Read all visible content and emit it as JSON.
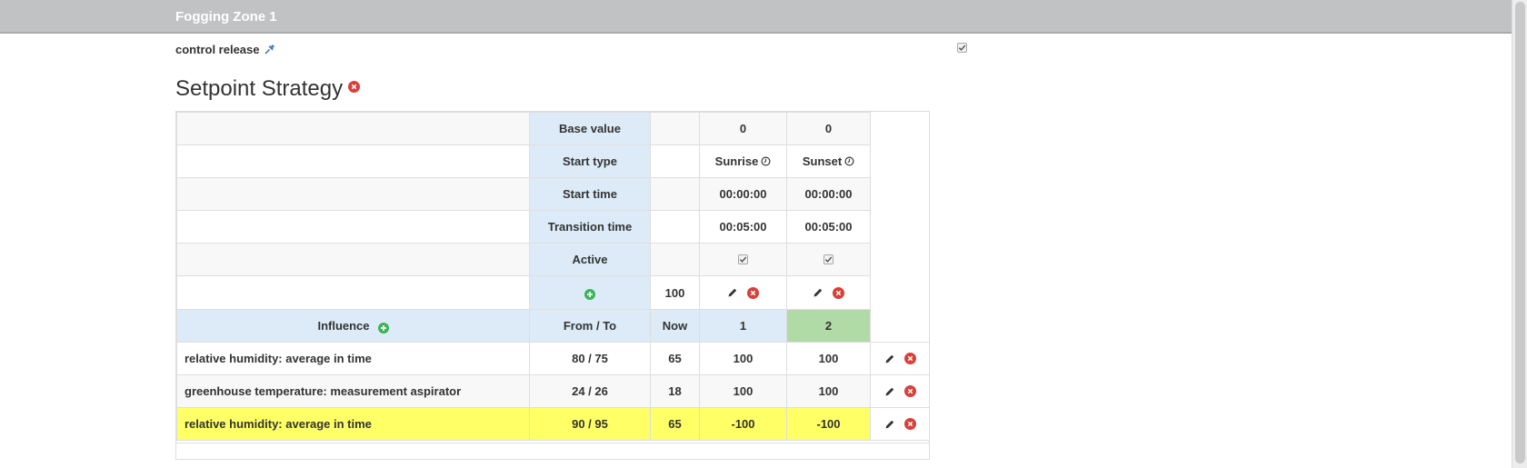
{
  "zone": {
    "title": "Fogging Zone 1"
  },
  "control_release": {
    "label": "control release",
    "checked": true
  },
  "section": {
    "title": "Setpoint Strategy"
  },
  "strategy": {
    "base_value_label": "Base value",
    "start_type_label": "Start type",
    "start_time_label": "Start time",
    "transition_time_label": "Transition time",
    "active_label": "Active",
    "base_now_value": "100",
    "columns": [
      {
        "number": "1",
        "base_value": "0",
        "start_type": "Sunrise",
        "start_time": "00:00:00",
        "transition_time": "00:05:00",
        "active": true
      },
      {
        "number": "2",
        "base_value": "0",
        "start_type": "Sunset",
        "start_time": "00:00:00",
        "transition_time": "00:05:00",
        "active": true
      }
    ],
    "header": {
      "influence": "Influence",
      "from_to": "From / To",
      "now": "Now"
    },
    "influences": [
      {
        "name": "relative humidity: average in time",
        "from_to": "80 / 75",
        "now": "65",
        "values": [
          "100",
          "100"
        ],
        "highlighted": false
      },
      {
        "name": "greenhouse temperature: measurement aspirator",
        "from_to": "24 / 26",
        "now": "18",
        "values": [
          "100",
          "100"
        ],
        "highlighted": false
      },
      {
        "name": "relative humidity: average in time",
        "from_to": "90 / 95",
        "now": "65",
        "values": [
          "-100",
          "-100"
        ],
        "highlighted": true
      }
    ]
  },
  "colors": {
    "header_bar": "#c1c2c4",
    "label_blue": "#dcebf7",
    "active_column_green": "#b0daa6",
    "highlight_yellow": "#ffff66",
    "remove_red": "#d9403a",
    "add_green": "#3cb45a",
    "pin_blue": "#4a7fc1"
  },
  "icons": {
    "remove": "remove-circle-icon",
    "add": "add-circle-icon",
    "edit": "pencil-icon",
    "clock": "clock-icon",
    "pin": "pin-icon",
    "check": "check-icon"
  }
}
